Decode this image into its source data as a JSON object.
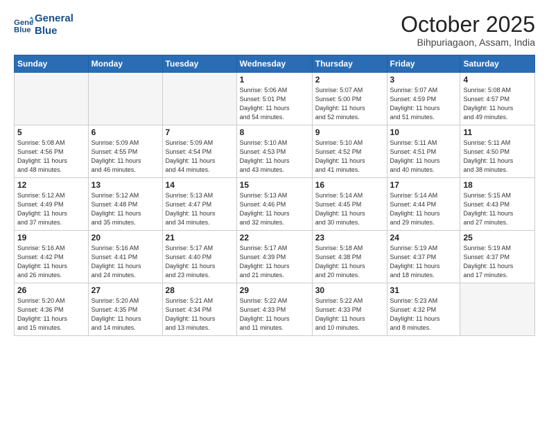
{
  "logo": {
    "line1": "General",
    "line2": "Blue"
  },
  "title": "October 2025",
  "location": "Bihpuriagaon, Assam, India",
  "days_of_week": [
    "Sunday",
    "Monday",
    "Tuesday",
    "Wednesday",
    "Thursday",
    "Friday",
    "Saturday"
  ],
  "weeks": [
    [
      {
        "day": "",
        "info": ""
      },
      {
        "day": "",
        "info": ""
      },
      {
        "day": "",
        "info": ""
      },
      {
        "day": "1",
        "info": "Sunrise: 5:06 AM\nSunset: 5:01 PM\nDaylight: 11 hours\nand 54 minutes."
      },
      {
        "day": "2",
        "info": "Sunrise: 5:07 AM\nSunset: 5:00 PM\nDaylight: 11 hours\nand 52 minutes."
      },
      {
        "day": "3",
        "info": "Sunrise: 5:07 AM\nSunset: 4:59 PM\nDaylight: 11 hours\nand 51 minutes."
      },
      {
        "day": "4",
        "info": "Sunrise: 5:08 AM\nSunset: 4:57 PM\nDaylight: 11 hours\nand 49 minutes."
      }
    ],
    [
      {
        "day": "5",
        "info": "Sunrise: 5:08 AM\nSunset: 4:56 PM\nDaylight: 11 hours\nand 48 minutes."
      },
      {
        "day": "6",
        "info": "Sunrise: 5:09 AM\nSunset: 4:55 PM\nDaylight: 11 hours\nand 46 minutes."
      },
      {
        "day": "7",
        "info": "Sunrise: 5:09 AM\nSunset: 4:54 PM\nDaylight: 11 hours\nand 44 minutes."
      },
      {
        "day": "8",
        "info": "Sunrise: 5:10 AM\nSunset: 4:53 PM\nDaylight: 11 hours\nand 43 minutes."
      },
      {
        "day": "9",
        "info": "Sunrise: 5:10 AM\nSunset: 4:52 PM\nDaylight: 11 hours\nand 41 minutes."
      },
      {
        "day": "10",
        "info": "Sunrise: 5:11 AM\nSunset: 4:51 PM\nDaylight: 11 hours\nand 40 minutes."
      },
      {
        "day": "11",
        "info": "Sunrise: 5:11 AM\nSunset: 4:50 PM\nDaylight: 11 hours\nand 38 minutes."
      }
    ],
    [
      {
        "day": "12",
        "info": "Sunrise: 5:12 AM\nSunset: 4:49 PM\nDaylight: 11 hours\nand 37 minutes."
      },
      {
        "day": "13",
        "info": "Sunrise: 5:12 AM\nSunset: 4:48 PM\nDaylight: 11 hours\nand 35 minutes."
      },
      {
        "day": "14",
        "info": "Sunrise: 5:13 AM\nSunset: 4:47 PM\nDaylight: 11 hours\nand 34 minutes."
      },
      {
        "day": "15",
        "info": "Sunrise: 5:13 AM\nSunset: 4:46 PM\nDaylight: 11 hours\nand 32 minutes."
      },
      {
        "day": "16",
        "info": "Sunrise: 5:14 AM\nSunset: 4:45 PM\nDaylight: 11 hours\nand 30 minutes."
      },
      {
        "day": "17",
        "info": "Sunrise: 5:14 AM\nSunset: 4:44 PM\nDaylight: 11 hours\nand 29 minutes."
      },
      {
        "day": "18",
        "info": "Sunrise: 5:15 AM\nSunset: 4:43 PM\nDaylight: 11 hours\nand 27 minutes."
      }
    ],
    [
      {
        "day": "19",
        "info": "Sunrise: 5:16 AM\nSunset: 4:42 PM\nDaylight: 11 hours\nand 26 minutes."
      },
      {
        "day": "20",
        "info": "Sunrise: 5:16 AM\nSunset: 4:41 PM\nDaylight: 11 hours\nand 24 minutes."
      },
      {
        "day": "21",
        "info": "Sunrise: 5:17 AM\nSunset: 4:40 PM\nDaylight: 11 hours\nand 23 minutes."
      },
      {
        "day": "22",
        "info": "Sunrise: 5:17 AM\nSunset: 4:39 PM\nDaylight: 11 hours\nand 21 minutes."
      },
      {
        "day": "23",
        "info": "Sunrise: 5:18 AM\nSunset: 4:38 PM\nDaylight: 11 hours\nand 20 minutes."
      },
      {
        "day": "24",
        "info": "Sunrise: 5:19 AM\nSunset: 4:37 PM\nDaylight: 11 hours\nand 18 minutes."
      },
      {
        "day": "25",
        "info": "Sunrise: 5:19 AM\nSunset: 4:37 PM\nDaylight: 11 hours\nand 17 minutes."
      }
    ],
    [
      {
        "day": "26",
        "info": "Sunrise: 5:20 AM\nSunset: 4:36 PM\nDaylight: 11 hours\nand 15 minutes."
      },
      {
        "day": "27",
        "info": "Sunrise: 5:20 AM\nSunset: 4:35 PM\nDaylight: 11 hours\nand 14 minutes."
      },
      {
        "day": "28",
        "info": "Sunrise: 5:21 AM\nSunset: 4:34 PM\nDaylight: 11 hours\nand 13 minutes."
      },
      {
        "day": "29",
        "info": "Sunrise: 5:22 AM\nSunset: 4:33 PM\nDaylight: 11 hours\nand 11 minutes."
      },
      {
        "day": "30",
        "info": "Sunrise: 5:22 AM\nSunset: 4:33 PM\nDaylight: 11 hours\nand 10 minutes."
      },
      {
        "day": "31",
        "info": "Sunrise: 5:23 AM\nSunset: 4:32 PM\nDaylight: 11 hours\nand 8 minutes."
      },
      {
        "day": "",
        "info": ""
      }
    ]
  ]
}
